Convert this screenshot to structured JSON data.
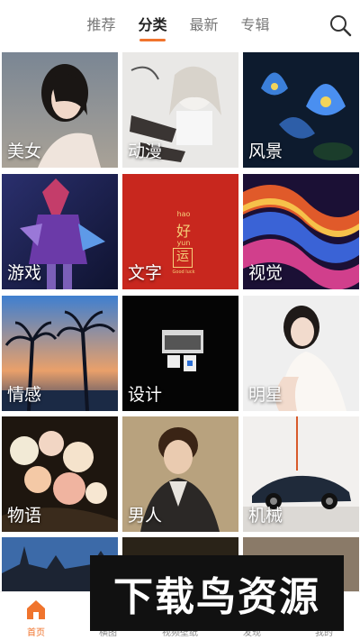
{
  "header": {
    "tabs": [
      {
        "label": "推荐"
      },
      {
        "label": "分类"
      },
      {
        "label": "最新"
      },
      {
        "label": "专辑"
      }
    ],
    "active_tab": "分类",
    "accent_color": "#f0742d",
    "search_icon": "search-icon"
  },
  "categories": [
    {
      "label": "美女"
    },
    {
      "label": "动漫"
    },
    {
      "label": "风景"
    },
    {
      "label": "游戏"
    },
    {
      "label": "文字"
    },
    {
      "label": "视觉"
    },
    {
      "label": "情感"
    },
    {
      "label": "设计"
    },
    {
      "label": "明星"
    },
    {
      "label": "物语"
    },
    {
      "label": "男人"
    },
    {
      "label": "机械"
    },
    {
      "label": ""
    },
    {
      "label": ""
    },
    {
      "label": ""
    }
  ],
  "text_tile": {
    "line1": "hao",
    "line2": "好",
    "line3": "yun",
    "line4": "运",
    "line5": "Good luck"
  },
  "bottom_nav": [
    {
      "label": "首页",
      "icon": "home-icon",
      "active": true
    },
    {
      "label": "横图",
      "icon": "landscape-icon"
    },
    {
      "label": "视频壁纸",
      "icon": "video-icon"
    },
    {
      "label": "发现",
      "icon": "discover-icon"
    },
    {
      "label": "我的",
      "icon": "profile-icon"
    }
  ],
  "watermark": {
    "text": "下载鸟资源"
  }
}
